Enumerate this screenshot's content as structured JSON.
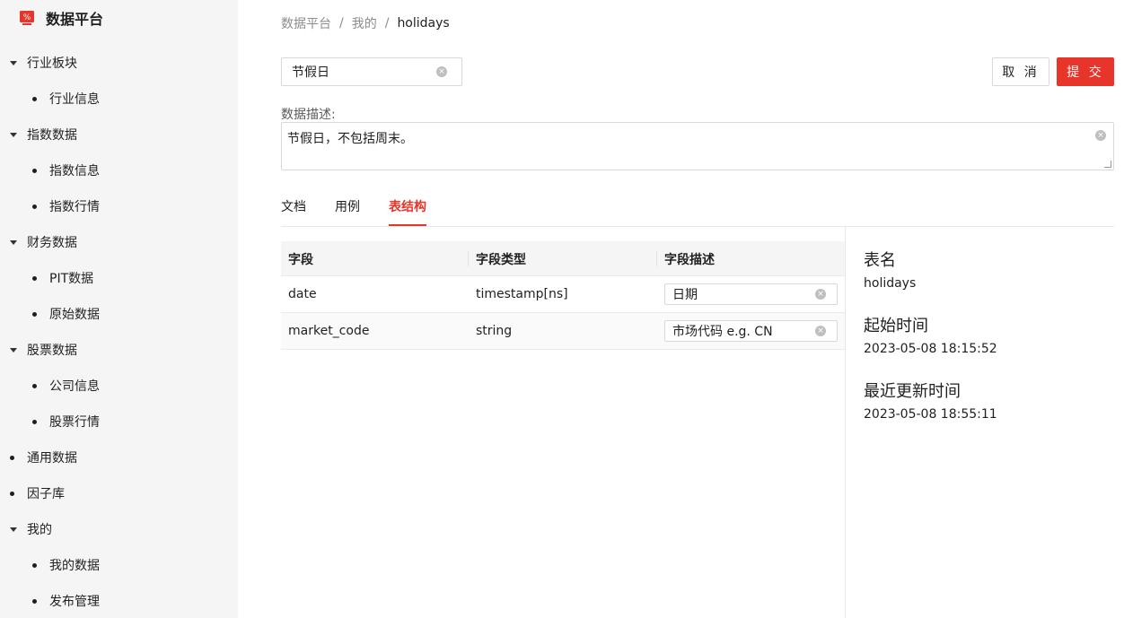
{
  "brand": {
    "title": "数据平台"
  },
  "sidebar": {
    "items": [
      {
        "label": "行业板块",
        "type": "group"
      },
      {
        "label": "行业信息",
        "type": "child"
      },
      {
        "label": "指数数据",
        "type": "group"
      },
      {
        "label": "指数信息",
        "type": "child"
      },
      {
        "label": "指数行情",
        "type": "child"
      },
      {
        "label": "财务数据",
        "type": "group"
      },
      {
        "label": "PIT数据",
        "type": "child"
      },
      {
        "label": "原始数据",
        "type": "child"
      },
      {
        "label": "股票数据",
        "type": "group"
      },
      {
        "label": "公司信息",
        "type": "child"
      },
      {
        "label": "股票行情",
        "type": "child"
      },
      {
        "label": "通用数据",
        "type": "leaf"
      },
      {
        "label": "因子库",
        "type": "leaf"
      },
      {
        "label": "我的",
        "type": "group"
      },
      {
        "label": "我的数据",
        "type": "child"
      },
      {
        "label": "发布管理",
        "type": "child"
      }
    ]
  },
  "breadcrumb": {
    "items": [
      "数据平台",
      "我的",
      "holidays"
    ],
    "separator": "/"
  },
  "form": {
    "title_value": "节假日",
    "desc_label": "数据描述:",
    "desc_value": "节假日，不包括周末。"
  },
  "actions": {
    "cancel_label": "取 消",
    "submit_label": "提 交"
  },
  "tabs": [
    {
      "label": "文档",
      "active": false
    },
    {
      "label": "用例",
      "active": false
    },
    {
      "label": "表结构",
      "active": true
    }
  ],
  "table": {
    "columns": [
      "字段",
      "字段类型",
      "字段描述"
    ],
    "rows": [
      {
        "field": "date",
        "type": "timestamp[ns]",
        "desc": "日期"
      },
      {
        "field": "market_code",
        "type": "string",
        "desc": "市场代码 e.g. CN"
      }
    ]
  },
  "info": {
    "table_name_label": "表名",
    "table_name": "holidays",
    "start_time_label": "起始时间",
    "start_time": "2023-05-08 18:15:52",
    "updated_label": "最近更新时间",
    "updated_time": "2023-05-08 18:55:11"
  },
  "colors": {
    "accent": "#e8352b",
    "sidebar_bg": "#f5f5f5",
    "table_header_bg": "#f5f5f5"
  }
}
